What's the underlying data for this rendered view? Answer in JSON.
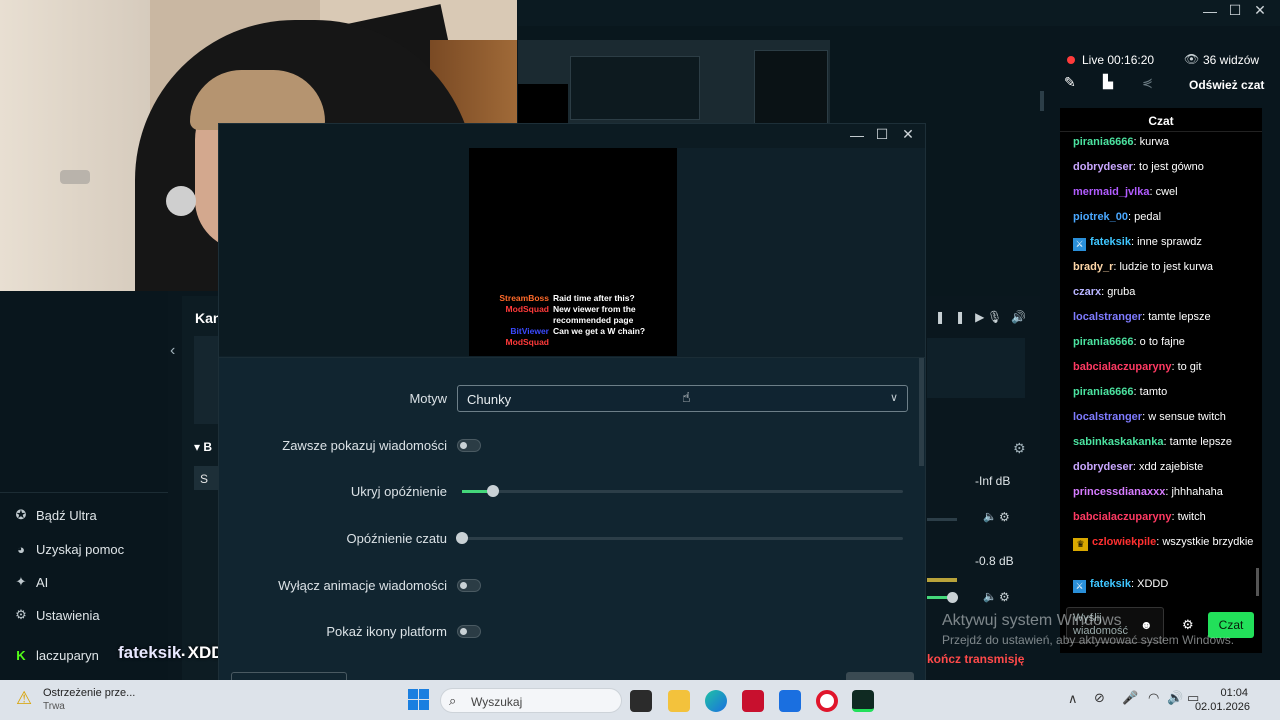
{
  "app": {
    "live_label": "Live 00:16:20",
    "viewers_label": "36 widzów",
    "refresh_chat": "Odśwież czat",
    "chat_header": "Czat",
    "partial_kan": "Kan",
    "partial_b": "B",
    "partial_s": "S",
    "db_1": "-Inf dB",
    "db_2": "-0.8 dB",
    "end_stream": "kończ transmisję"
  },
  "left_nav": {
    "items": [
      {
        "label": "Bądź Ultra",
        "icon": "ultra-icon"
      },
      {
        "label": "Uzyskaj pomoc",
        "icon": "help-icon"
      },
      {
        "label": "AI",
        "icon": "ai-sparkle-icon"
      },
      {
        "label": "Ustawienia",
        "icon": "gear-icon"
      },
      {
        "label": "laczuparyn",
        "icon": "kick-icon"
      }
    ]
  },
  "overlay_text": {
    "user": "fateksik",
    "message": "XDDD"
  },
  "settings": {
    "theme_label": "Motyw",
    "theme_value": "Chunky",
    "always_show_label": "Zawsze pokazuj wiadomości",
    "hide_delay_label": "Ukryj opóźnienie",
    "hide_delay_value": 0.07,
    "chat_delay_label": "Opóźnienie czatu",
    "chat_delay_value": 0,
    "disable_anim_label": "Wyłącz animacje wiadomości",
    "show_platform_label": "Pokaż ikony platform"
  },
  "chat_preview": [
    {
      "user": "StreamBoss",
      "msg": "Raid time after this?",
      "color": "#ff6a2a"
    },
    {
      "user": "ModSquad",
      "msg": "New viewer from the recommended page",
      "color": "#ff3a3a"
    },
    {
      "user": "BitViewer",
      "msg": "Can we get a W chain?",
      "color": "#3a4aff"
    },
    {
      "user": "ModSquad",
      "msg": "",
      "color": "#ff3a3a"
    }
  ],
  "chat": {
    "messages": [
      {
        "user": "pirania6666",
        "msg": "kurwa",
        "color": "#4be3a0",
        "badge": false
      },
      {
        "user": "dobrydeser",
        "msg": "to jest gówno",
        "color": "#c9a7ff",
        "badge": false
      },
      {
        "user": "mermaid_jvlka",
        "msg": "cwel",
        "color": "#b15cff",
        "badge": false
      },
      {
        "user": "piotrek_00",
        "msg": "pedal",
        "color": "#4aa8ff",
        "badge": false
      },
      {
        "user": "fateksik",
        "msg": "inne sprawdz",
        "color": "#3fc6ff",
        "badge": true
      },
      {
        "user": "brady_r",
        "msg": "ludzie to jest kurwa",
        "color": "#ffd7a8",
        "badge": false
      },
      {
        "user": "czarx",
        "msg": "gruba",
        "color": "#b8b4ff",
        "badge": false
      },
      {
        "user": "localstranger",
        "msg": "tamte lepsze",
        "color": "#7f7bff",
        "badge": false
      },
      {
        "user": "pirania6666",
        "msg": "o to fajne",
        "color": "#4be3a0",
        "badge": false
      },
      {
        "user": "babcialaczuparyny",
        "msg": "to git",
        "color": "#ff3a63",
        "badge": false
      },
      {
        "user": "pirania6666",
        "msg": "tamto",
        "color": "#4be3a0",
        "badge": false
      },
      {
        "user": "localstranger",
        "msg": "w sensue twitch",
        "color": "#7f7bff",
        "badge": false
      },
      {
        "user": "sabinkaskakanka",
        "msg": "tamte lepsze",
        "color": "#4be3a0",
        "badge": false
      },
      {
        "user": "dobrydeser",
        "msg": "xdd zajebiste",
        "color": "#c9a7ff",
        "badge": false
      },
      {
        "user": "princessdianaxxx",
        "msg": "jhhhahaha",
        "color": "#d67cff",
        "badge": false
      },
      {
        "user": "babcialaczuparyny",
        "msg": "twitch",
        "color": "#ff3a63",
        "badge": false
      },
      {
        "user": "czlowiekpile",
        "msg": "wszystkie brzydkie",
        "color": "#ff3030",
        "badge": "crown"
      },
      {
        "user": "fateksik",
        "msg": "XDDD",
        "color": "#3fc6ff",
        "badge": true
      }
    ],
    "input_placeholder": "Wyślij wiadomość",
    "send_button": "Czat"
  },
  "windows_activation": {
    "title": "Aktywuj system Windows",
    "subtitle": "Przejdź do ustawień, aby aktywować system Windows."
  },
  "taskbar": {
    "notification_title": "Ostrzeżenie prze...",
    "notification_sub": "Trwa",
    "search_placeholder": "Wyszukaj",
    "time": "01:04",
    "date": "02.01.2026"
  },
  "colors": {
    "accent_green": "#22e05a",
    "live_red": "#ff3b3b",
    "slider_green": "#44d77a"
  }
}
